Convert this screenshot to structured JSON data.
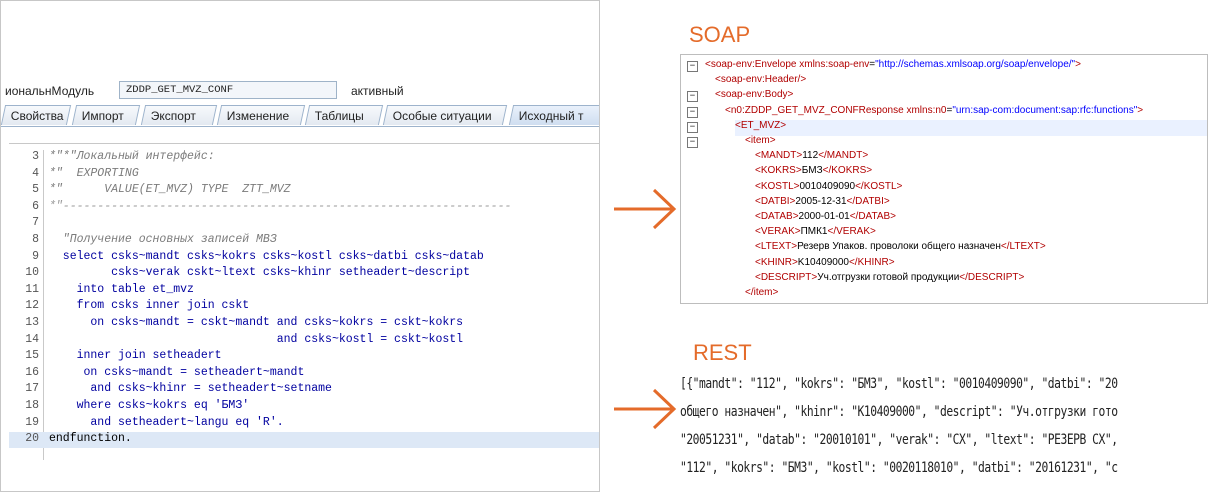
{
  "sap": {
    "fm_label": "иональнМодуль",
    "fm_name": "ZDDP_GET_MVZ_CONF",
    "fm_status": "активный",
    "tabs": [
      {
        "label": "Свойства"
      },
      {
        "label": "Импорт"
      },
      {
        "label": "Экспорт"
      },
      {
        "label": "Изменение"
      },
      {
        "label": "Таблицы"
      },
      {
        "label": "Особые ситуации"
      },
      {
        "label": "Исходный т"
      }
    ],
    "active_tab": "Исходный т",
    "code_lines": [
      {
        "n": "3",
        "text": "*\"*\"Локальный интерфейс:",
        "kind": "cmt"
      },
      {
        "n": "4",
        "text": "*\"  EXPORTING",
        "kind": "cmt"
      },
      {
        "n": "5",
        "text": "*\"      VALUE(ET_MVZ) TYPE  ZTT_MVZ",
        "kind": "cmt"
      },
      {
        "n": "6",
        "text": "*\"-----------------------------------------------------------------",
        "kind": "dash"
      },
      {
        "n": "7",
        "text": "",
        "kind": "code"
      },
      {
        "n": "8",
        "text": "  \"Получение основных записей МВЗ",
        "kind": "cmt"
      },
      {
        "n": "9",
        "text": "  select csks~mandt csks~kokrs csks~kostl csks~datbi csks~datab",
        "kind": "code"
      },
      {
        "n": "10",
        "text": "         csks~verak cskt~ltext csks~khinr setheadert~descript",
        "kind": "code"
      },
      {
        "n": "11",
        "text": "    into table et_mvz",
        "kind": "code"
      },
      {
        "n": "12",
        "text": "    from csks inner join cskt",
        "kind": "code"
      },
      {
        "n": "13",
        "text": "      on csks~mandt = cskt~mandt and csks~kokrs = cskt~kokrs",
        "kind": "code"
      },
      {
        "n": "14",
        "text": "                                 and csks~kostl = cskt~kostl",
        "kind": "code"
      },
      {
        "n": "15",
        "text": "    inner join setheadert",
        "kind": "code"
      },
      {
        "n": "16",
        "text": "     on csks~mandt = setheadert~mandt",
        "kind": "code"
      },
      {
        "n": "17",
        "text": "      and csks~khinr = setheadert~setname",
        "kind": "code"
      },
      {
        "n": "18",
        "text": "    where csks~kokrs eq 'БМЗ'",
        "kind": "code"
      },
      {
        "n": "19",
        "text": "      and setheadert~langu eq 'R'.",
        "kind": "code"
      },
      {
        "n": "20",
        "text": "endfunction.",
        "kind": "end"
      }
    ]
  },
  "soap": {
    "title": "SOAP",
    "lines": [
      {
        "toggle": "−",
        "parts": [
          [
            "t",
            "<soap-env:Envelope "
          ],
          [
            "attr",
            "xmlns:soap-env"
          ],
          [
            "v",
            "="
          ],
          [
            "av",
            "\"http://schemas.xmlsoap.org/soap/envelope/\""
          ],
          [
            "t",
            ">"
          ]
        ]
      },
      {
        "toggle": "",
        "parts": [
          [
            "t",
            "<soap-env:Header/>"
          ]
        ]
      },
      {
        "toggle": "−",
        "parts": [
          [
            "t",
            "<soap-env:Body>"
          ]
        ]
      },
      {
        "toggle": "−",
        "parts": [
          [
            "t",
            "<n0:ZDDP_GET_MVZ_CONFResponse "
          ],
          [
            "attr",
            "xmlns:n0"
          ],
          [
            "v",
            "="
          ],
          [
            "av",
            "\"urn:sap-com:document:sap:rfc:functions\""
          ],
          [
            "t",
            ">"
          ]
        ]
      },
      {
        "toggle": "−",
        "parts": [
          [
            "t",
            "<ET_MVZ>"
          ]
        ]
      },
      {
        "toggle": "−",
        "parts": [
          [
            "t",
            "<item>"
          ]
        ]
      },
      {
        "toggle": "",
        "parts": [
          [
            "t",
            "<MANDT>"
          ],
          [
            "v",
            "112"
          ],
          [
            "t",
            "</MANDT>"
          ]
        ]
      },
      {
        "toggle": "",
        "parts": [
          [
            "t",
            "<KOKRS>"
          ],
          [
            "v",
            "БМЗ"
          ],
          [
            "t",
            "</KOKRS>"
          ]
        ]
      },
      {
        "toggle": "",
        "parts": [
          [
            "t",
            "<KOSTL>"
          ],
          [
            "v",
            "0010409090"
          ],
          [
            "t",
            "</KOSTL>"
          ]
        ]
      },
      {
        "toggle": "",
        "parts": [
          [
            "t",
            "<DATBI>"
          ],
          [
            "v",
            "2005-12-31"
          ],
          [
            "t",
            "</DATBI>"
          ]
        ]
      },
      {
        "toggle": "",
        "parts": [
          [
            "t",
            "<DATAB>"
          ],
          [
            "v",
            "2000-01-01"
          ],
          [
            "t",
            "</DATAB>"
          ]
        ]
      },
      {
        "toggle": "",
        "parts": [
          [
            "t",
            "<VERAK>"
          ],
          [
            "v",
            "ПМК1"
          ],
          [
            "t",
            "</VERAK>"
          ]
        ]
      },
      {
        "toggle": "",
        "parts": [
          [
            "t",
            "<LTEXT>"
          ],
          [
            "v",
            "Резерв Упаков. проволоки общего назначен"
          ],
          [
            "t",
            "</LTEXT>"
          ]
        ]
      },
      {
        "toggle": "",
        "parts": [
          [
            "t",
            "<KHINR>"
          ],
          [
            "v",
            "K10409000"
          ],
          [
            "t",
            "</KHINR>"
          ]
        ]
      },
      {
        "toggle": "",
        "parts": [
          [
            "t",
            "<DESCRIPT>"
          ],
          [
            "v",
            "Уч.отгрузки готовой продукции"
          ],
          [
            "t",
            "</DESCRIPT>"
          ]
        ]
      },
      {
        "toggle": "",
        "parts": [
          [
            "t",
            "</item>"
          ]
        ]
      }
    ]
  },
  "rest": {
    "title": "REST",
    "lines": [
      "[{\"mandt\": \"112\", \"kokrs\": \"БМЗ\", \"kostl\": \"0010409090\", \"datbi\": \"20",
      "общего назначен\", \"khinr\": \"K10409000\", \"descript\": \"Уч.отгрузки гото",
      "\"20051231\", \"datab\": \"20010101\", \"verak\": \"CX\", \"ltext\": \"РЕЗЕРВ CX\",",
      "\"112\", \"kokrs\": \"БМЗ\", \"kostl\": \"0020118010\", \"datbi\": \"20161231\", \"c"
    ]
  },
  "colors": {
    "accent_orange": "#e46b2a",
    "xml_tag": "#b10000",
    "xml_attr_value": "#0000ff",
    "abap_keyword": "#00009f"
  }
}
